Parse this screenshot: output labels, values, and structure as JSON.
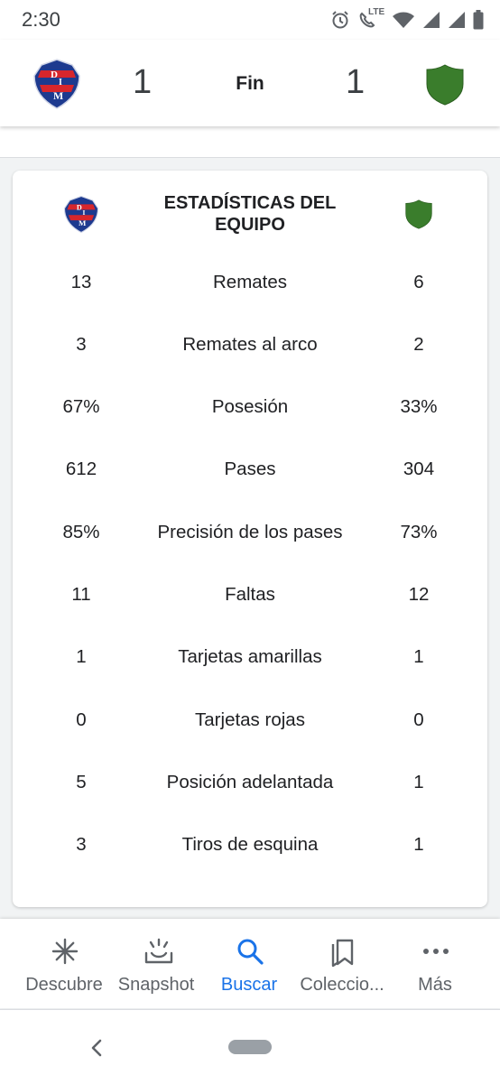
{
  "status_bar": {
    "time": "2:30",
    "network": "LTE",
    "icons": [
      "alarm-icon",
      "wifi-calling-lte-icon",
      "wifi-icon",
      "cell-signal-icon",
      "cell-signal-icon",
      "battery-icon"
    ]
  },
  "match": {
    "home_score": "1",
    "status": "Fin",
    "away_score": "1",
    "home_crest_letters": "DIM",
    "away_crest_color": "#3a7d2c",
    "home_crest_color": "#1d3a8f",
    "home_crest_accent": "#d7262c"
  },
  "stats": {
    "title": "ESTADÍSTICAS DEL EQUIPO",
    "rows": [
      {
        "home": "13",
        "label": "Remates",
        "away": "6"
      },
      {
        "home": "3",
        "label": "Remates al arco",
        "away": "2"
      },
      {
        "home": "67%",
        "label": "Posesión",
        "away": "33%"
      },
      {
        "home": "612",
        "label": "Pases",
        "away": "304"
      },
      {
        "home": "85%",
        "label": "Precisión de los pases",
        "away": "73%"
      },
      {
        "home": "11",
        "label": "Faltas",
        "away": "12"
      },
      {
        "home": "1",
        "label": "Tarjetas amarillas",
        "away": "1"
      },
      {
        "home": "0",
        "label": "Tarjetas rojas",
        "away": "0"
      },
      {
        "home": "5",
        "label": "Posición adelantada",
        "away": "1"
      },
      {
        "home": "3",
        "label": "Tiros de esquina",
        "away": "1"
      }
    ]
  },
  "bottom_nav": {
    "items": [
      {
        "label": "Descubre",
        "icon": "asterisk-icon"
      },
      {
        "label": "Snapshot",
        "icon": "snapshot-icon"
      },
      {
        "label": "Buscar",
        "icon": "search-icon",
        "active": true
      },
      {
        "label": "Coleccio...",
        "icon": "collections-icon"
      },
      {
        "label": "Más",
        "icon": "more-dots-icon"
      }
    ],
    "active_color": "#1a73e8"
  }
}
